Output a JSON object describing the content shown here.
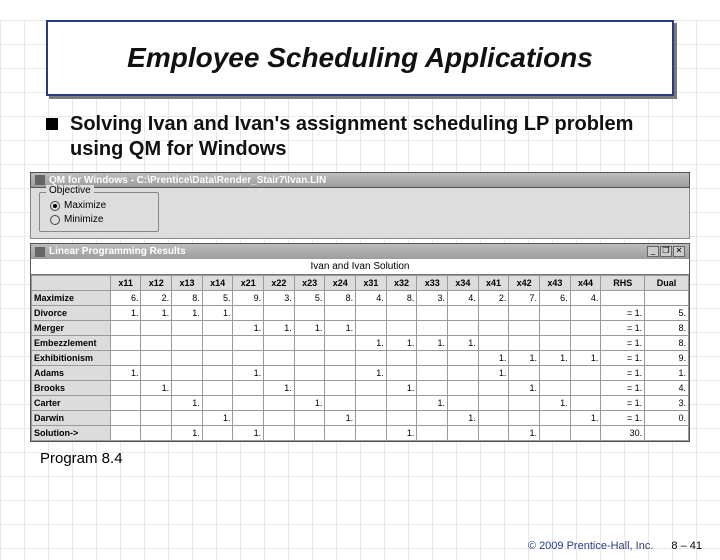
{
  "slide": {
    "title": "Employee Scheduling Applications",
    "bullet": "Solving Ivan and Ivan's assignment scheduling LP problem using QM for Windows",
    "caption": "Program 8.4",
    "copyright": "© 2009 Prentice-Hall, Inc.",
    "page": "8 – 41"
  },
  "app": {
    "window_title": "QM for Windows - C:\\Prentice\\Data\\Render_Stair7\\Ivan.LIN",
    "objective_label": "Objective",
    "radio_max": "Maximize",
    "radio_min": "Minimize",
    "radio_selected": "Maximize",
    "subwindow_title": "Linear Programming Results",
    "solution_title": "Ivan and Ivan Solution",
    "btn_min": "_",
    "btn_restore": "❐",
    "btn_close": "✕"
  },
  "chart_data": {
    "type": "table",
    "columns": [
      "x11",
      "x12",
      "x13",
      "x14",
      "x21",
      "x22",
      "x23",
      "x24",
      "x31",
      "x32",
      "x33",
      "x34",
      "x41",
      "x42",
      "x43",
      "x44",
      "RHS",
      "Dual"
    ],
    "rows": [
      {
        "name": "Maximize",
        "v": [
          "6.",
          "2.",
          "8.",
          "5.",
          "9.",
          "3.",
          "5.",
          "8.",
          "4.",
          "8.",
          "3.",
          "4.",
          "2.",
          "7.",
          "6.",
          "4.",
          "",
          ""
        ]
      },
      {
        "name": "Divorce",
        "v": [
          "1.",
          "1.",
          "1.",
          "1.",
          "",
          "",
          "",
          "",
          "",
          "",
          "",
          "",
          "",
          "",
          "",
          "",
          "=   1.",
          "5."
        ]
      },
      {
        "name": "Merger",
        "v": [
          "",
          "",
          "",
          "",
          "1.",
          "1.",
          "1.",
          "1.",
          "",
          "",
          "",
          "",
          "",
          "",
          "",
          "",
          "=   1.",
          "8."
        ]
      },
      {
        "name": "Embezzlement",
        "v": [
          "",
          "",
          "",
          "",
          "",
          "",
          "",
          "",
          "1.",
          "1.",
          "1.",
          "1.",
          "",
          "",
          "",
          "",
          "=   1.",
          "8."
        ]
      },
      {
        "name": "Exhibitionism",
        "v": [
          "",
          "",
          "",
          "",
          "",
          "",
          "",
          "",
          "",
          "",
          "",
          "",
          "1.",
          "1.",
          "1.",
          "1.",
          "=   1.",
          "9."
        ]
      },
      {
        "name": "Adams",
        "v": [
          "1.",
          "",
          "",
          "",
          "1.",
          "",
          "",
          "",
          "1.",
          "",
          "",
          "",
          "1.",
          "",
          "",
          "",
          "=   1.",
          "1."
        ]
      },
      {
        "name": "Brooks",
        "v": [
          "",
          "1.",
          "",
          "",
          "",
          "1.",
          "",
          "",
          "",
          "1.",
          "",
          "",
          "",
          "1.",
          "",
          "",
          "=   1.",
          "4."
        ]
      },
      {
        "name": "Carter",
        "v": [
          "",
          "",
          "1.",
          "",
          "",
          "",
          "1.",
          "",
          "",
          "",
          "1.",
          "",
          "",
          "",
          "1.",
          "",
          "=   1.",
          "3."
        ]
      },
      {
        "name": "Darwin",
        "v": [
          "",
          "",
          "",
          "1.",
          "",
          "",
          "",
          "1.",
          "",
          "",
          "",
          "1.",
          "",
          "",
          "",
          "1.",
          "=   1.",
          "0."
        ]
      },
      {
        "name": "Solution->",
        "v": [
          "",
          "",
          "1.",
          "",
          "1.",
          "",
          "",
          "",
          "",
          "1.",
          "",
          "",
          "",
          "1.",
          "",
          "",
          "30.",
          ""
        ]
      }
    ]
  }
}
